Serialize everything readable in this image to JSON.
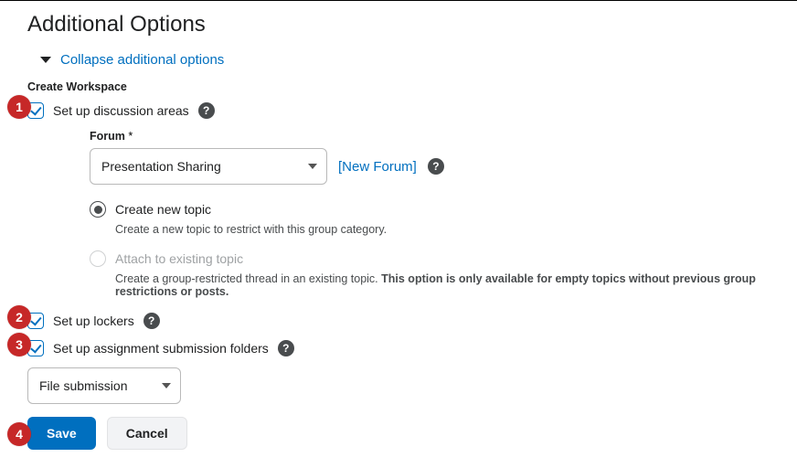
{
  "title": "Additional Options",
  "collapse_label": "Collapse additional options",
  "section_label": "Create Workspace",
  "discussion": {
    "label": "Set up discussion areas",
    "forum_label": "Forum",
    "forum_required": "*",
    "forum_value": "Presentation Sharing",
    "new_forum_link": "[New Forum]",
    "options": {
      "create_new": {
        "label": "Create new topic",
        "desc": "Create a new topic to restrict with this group category."
      },
      "attach_existing": {
        "label": "Attach to existing topic",
        "desc_prefix": "Create a group-restricted thread in an existing topic. ",
        "desc_locked": "This option is only available for empty topics without previous group restrictions or posts."
      }
    }
  },
  "lockers": {
    "label": "Set up lockers"
  },
  "assignment": {
    "label": "Set up assignment submission folders"
  },
  "submission_type": "File submission",
  "buttons": {
    "save": "Save",
    "cancel": "Cancel"
  },
  "steps": {
    "s1": "1",
    "s2": "2",
    "s3": "3",
    "s4": "4"
  }
}
